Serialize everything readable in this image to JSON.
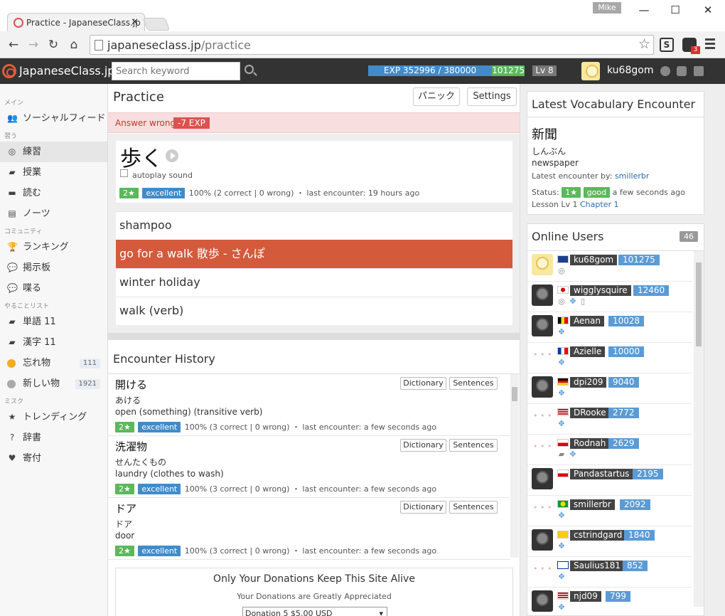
{
  "browser": {
    "tab_title": "Practice - JapaneseClass.jp",
    "profile": "Mike",
    "url_host": "japaneseclass.jp",
    "url_path": "/practice",
    "ext_badge": "3"
  },
  "header": {
    "brand": "JapaneseClass.jp",
    "search_placeholder": "Search keyword",
    "exp_text": "EXP 352996 / 380000",
    "exp_progress": 0.929,
    "points": "101275",
    "level": "Lv 8",
    "username": "ku68gom"
  },
  "sidebar": {
    "sections": [
      {
        "title": "メイン",
        "items": [
          {
            "label": "ソーシャルフィード",
            "icon": "users-icon"
          }
        ]
      },
      {
        "title": "習う",
        "items": [
          {
            "label": "練習",
            "icon": "target-icon",
            "active": true
          },
          {
            "label": "授業",
            "icon": "book-icon"
          },
          {
            "label": "読む",
            "icon": "reader-icon"
          },
          {
            "label": "ノーツ",
            "icon": "notes-icon"
          }
        ]
      },
      {
        "title": "コミュニティ",
        "items": [
          {
            "label": "ランキング",
            "icon": "trophy-icon"
          },
          {
            "label": "掲示板",
            "icon": "board-icon"
          },
          {
            "label": "喋る",
            "icon": "chat-icon"
          }
        ]
      },
      {
        "title": "やることリスト",
        "items": [
          {
            "label": "単語 11",
            "icon": "book-icon"
          },
          {
            "label": "漢字 11",
            "icon": "book-icon"
          },
          {
            "label": "忘れ物",
            "icon": "dot-orange",
            "count": "111"
          },
          {
            "label": "新しい物",
            "icon": "dot-grey",
            "count": "1921"
          }
        ]
      },
      {
        "title": "ミスク",
        "items": [
          {
            "label": "トレンディング",
            "icon": "star-icon"
          },
          {
            "label": "辞書",
            "icon": "question-icon"
          },
          {
            "label": "寄付",
            "icon": "heart-icon"
          }
        ]
      }
    ]
  },
  "practice": {
    "title": "Practice",
    "panic_label": "パニック",
    "settings_label": "Settings",
    "alert_text": "Answer wrong",
    "alert_badge": "-7 EXP",
    "word": "歩く",
    "autoplay_label": "autoplay sound",
    "stars": "2★",
    "grade": "excellent",
    "stats": "100% (2 correct | 0 wrong) ・ last encounter: 19 hours ago",
    "choices": [
      "shampoo",
      "go for a walk  散歩 - さんぽ",
      "winter holiday",
      "walk (verb)"
    ]
  },
  "history": {
    "title": "Encounter History",
    "dict_label": "Dictionary",
    "sent_label": "Sentences",
    "rows": [
      {
        "word": "開ける",
        "reading": "あける",
        "meaning": "open (something) (transitive verb)",
        "stars": "2★",
        "grade": "excellent",
        "stats": "100% (3 correct | 0 wrong) ・ last encounter: a few seconds ago"
      },
      {
        "word": "洗濯物",
        "reading": "せんたくもの",
        "meaning": "laundry (clothes to wash)",
        "stars": "2★",
        "grade": "excellent",
        "stats": "100% (3 correct | 0 wrong) ・ last encounter: a few seconds ago"
      },
      {
        "word": "ドア",
        "reading": "ドア",
        "meaning": "door",
        "stars": "2★",
        "grade": "excellent",
        "stats": "100% (3 correct | 0 wrong) ・ last encounter: a few seconds ago"
      }
    ]
  },
  "donation": {
    "title": "Only Your Donations Keep This Site Alive",
    "subtitle": "Your Donations are Greatly Appreciated",
    "select_value": "Donation 5 $5.00 USD"
  },
  "vocab": {
    "title": "Latest Vocabulary Encounter",
    "word": "新聞",
    "reading": "しんぶん",
    "meaning": "newspaper",
    "by_label": "Latest encounter by:",
    "by_user": "smillerbr",
    "status_label": "Status:",
    "stars": "1★",
    "grade": "good",
    "time": "a few seconds ago",
    "lesson_label": "Lesson Lv 1",
    "chapter": "Chapter 1"
  },
  "online": {
    "title": "Online Users",
    "count": "46",
    "users": [
      {
        "name": "ku68gom",
        "points": "101275",
        "flag": "uk",
        "avatar": "chick",
        "icons": [
          "target-icon"
        ]
      },
      {
        "name": "wigglysquire",
        "points": "12460",
        "flag": "jp",
        "avatar": "dark",
        "icons": [
          "target-icon",
          "move-icon",
          "mobile-icon"
        ]
      },
      {
        "name": "Aenan",
        "points": "10028",
        "flag": "be",
        "avatar": "dark",
        "icons": [
          "move-icon"
        ]
      },
      {
        "name": "Azielle",
        "points": "10000",
        "flag": "fr",
        "avatar": "dots",
        "icons": [
          "move-icon"
        ]
      },
      {
        "name": "dpi209",
        "points": "9040",
        "flag": "de",
        "avatar": "dark",
        "icons": [
          "move-icon"
        ]
      },
      {
        "name": "DRooke",
        "points": "2772",
        "flag": "us",
        "avatar": "dots",
        "icons": [
          "move-icon"
        ]
      },
      {
        "name": "Rodnah",
        "points": "2629",
        "flag": "cz",
        "avatar": "dots",
        "icons": [
          "book-icon",
          "move-icon"
        ]
      },
      {
        "name": "Pandastartus",
        "points": "2195",
        "flag": "cz",
        "avatar": "dark",
        "icons": []
      },
      {
        "name": "smillerbr",
        "points": "2092",
        "flag": "br",
        "avatar": "dots",
        "icons": [
          "move-icon"
        ]
      },
      {
        "name": "cstrindgard",
        "points": "1840",
        "flag": "se",
        "avatar": "dark",
        "icons": [
          "move-icon"
        ]
      },
      {
        "name": "Saulius181",
        "points": "852",
        "flag": "fi",
        "avatar": "dots",
        "icons": [
          "move-icon"
        ]
      },
      {
        "name": "njd09",
        "points": "799",
        "flag": "us",
        "avatar": "dark",
        "icons": [
          "move-icon"
        ]
      }
    ]
  }
}
